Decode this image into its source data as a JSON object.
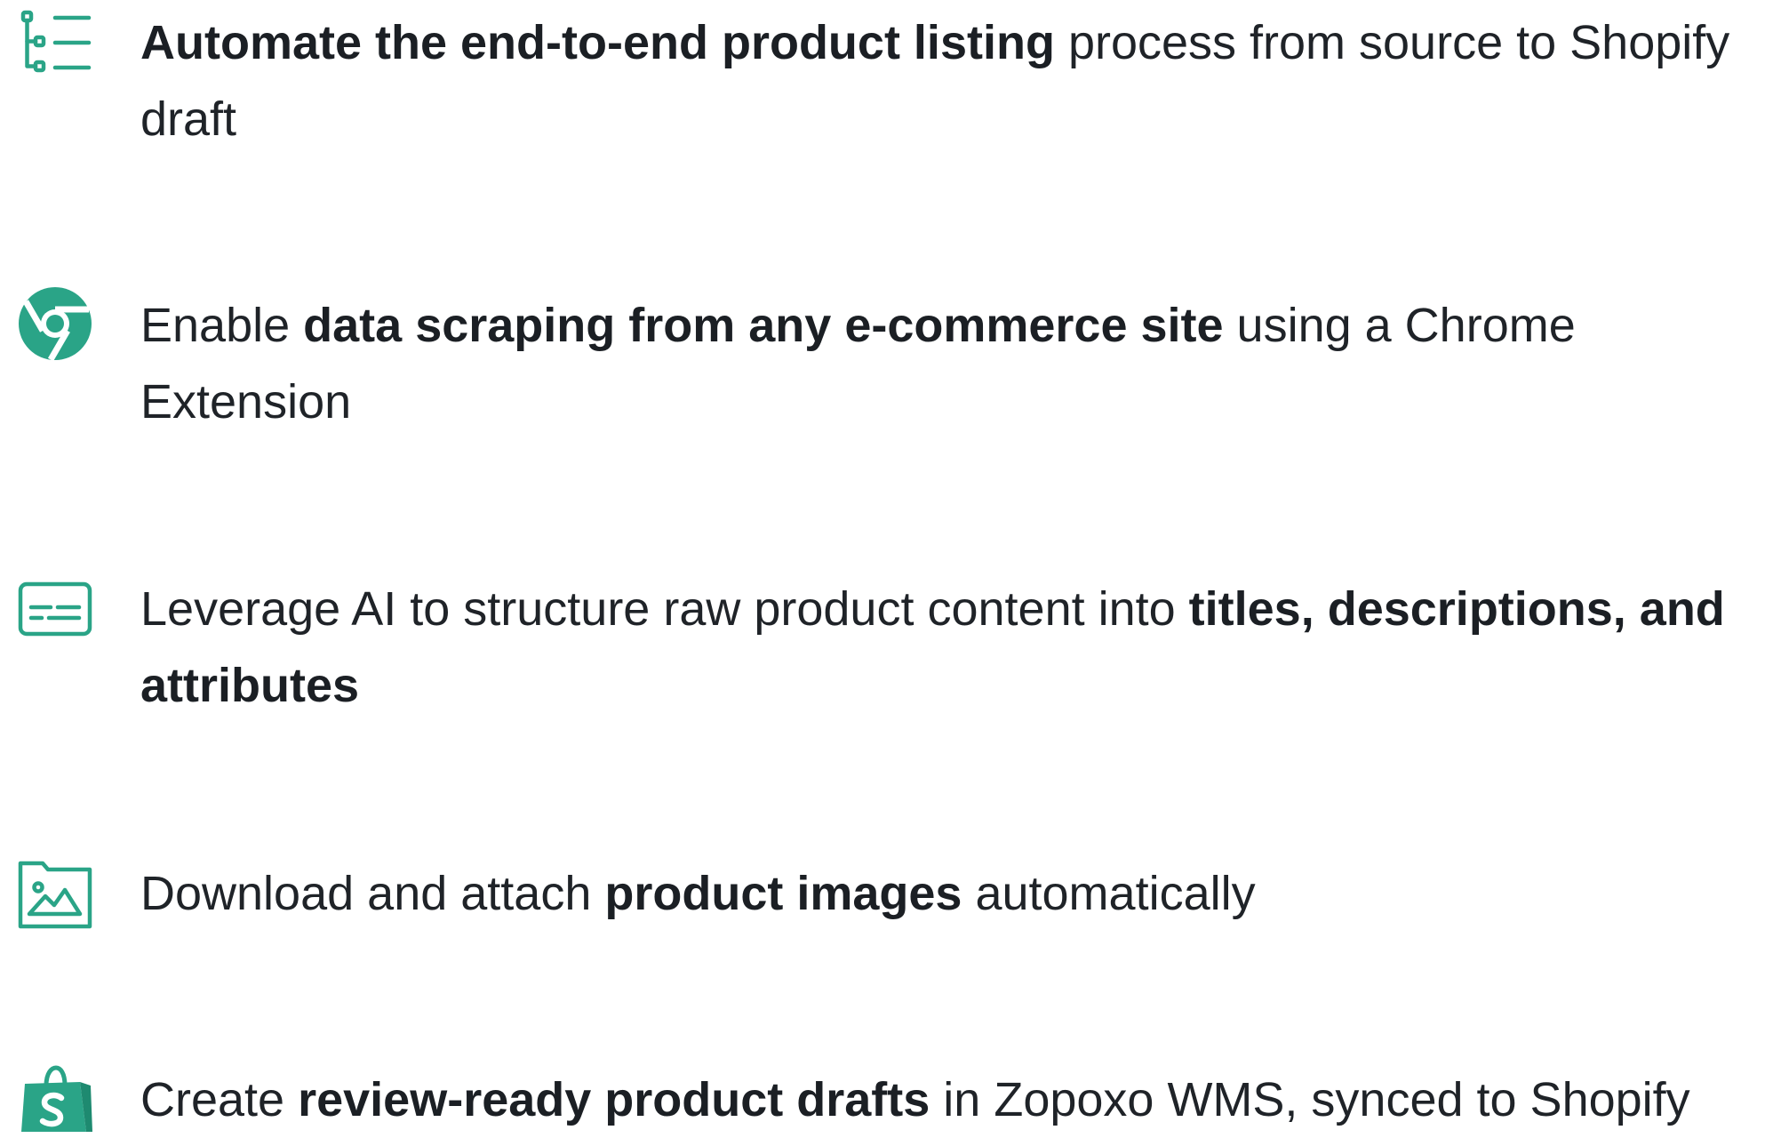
{
  "accent_color": "#2aa487",
  "features": [
    {
      "icon": "list-tree-icon",
      "parts": [
        {
          "text": "Automate the end-to-end product listing",
          "bold": true
        },
        {
          "text": " process from source to Shopify draft",
          "bold": false
        }
      ]
    },
    {
      "icon": "chrome-icon",
      "parts": [
        {
          "text": "Enable ",
          "bold": false
        },
        {
          "text": "data scraping from any e-commerce site",
          "bold": true
        },
        {
          "text": " using a Chrome Extension",
          "bold": false
        }
      ]
    },
    {
      "icon": "subtitles-icon",
      "parts": [
        {
          "text": "Leverage AI to structure raw product content into ",
          "bold": false
        },
        {
          "text": "titles, descriptions, and attributes",
          "bold": true
        }
      ]
    },
    {
      "icon": "image-folder-icon",
      "parts": [
        {
          "text": "Download and attach ",
          "bold": false
        },
        {
          "text": "product images",
          "bold": true
        },
        {
          "text": " automatically",
          "bold": false
        }
      ]
    },
    {
      "icon": "shopify-bag-icon",
      "parts": [
        {
          "text": "Create ",
          "bold": false
        },
        {
          "text": "review-ready product drafts",
          "bold": true
        },
        {
          "text": " in Zopoxo WMS, synced to Shopify",
          "bold": false
        }
      ]
    }
  ]
}
